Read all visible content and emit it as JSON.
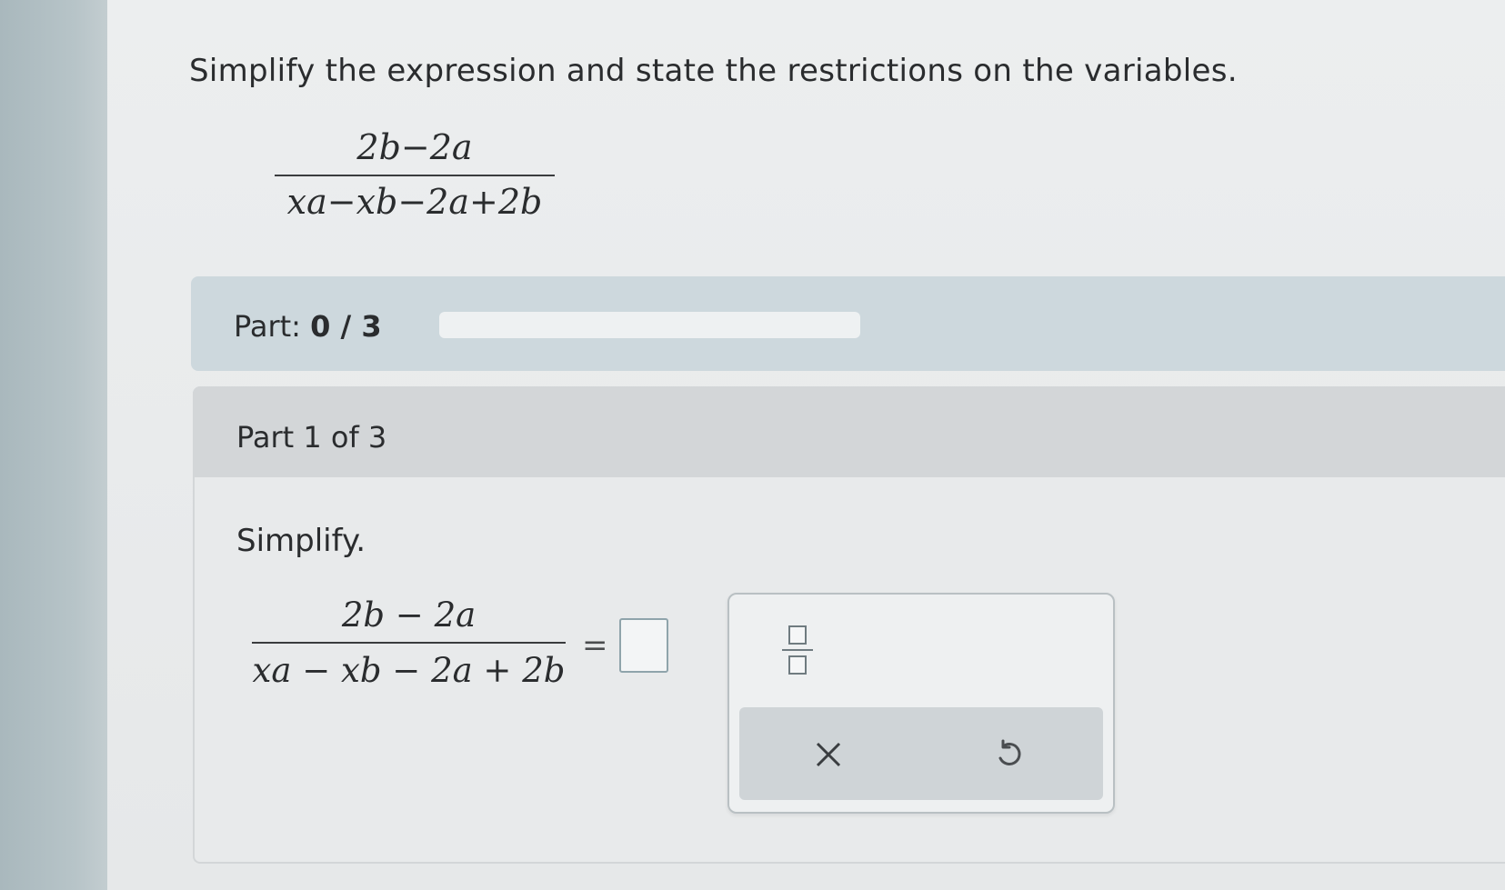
{
  "question": {
    "prompt": "Simplify the expression and state the restrictions on the variables.",
    "expression": {
      "numerator": "2b−2a",
      "denominator": "xa−xb−2a+2b"
    }
  },
  "progress": {
    "label": "Part:",
    "value": "0 / 3",
    "fraction": 0
  },
  "part": {
    "heading": "Part 1 of 3",
    "instruction": "Simplify.",
    "expression": {
      "numerator": "2b − 2a",
      "denominator": "xa − xb − 2a + 2b"
    },
    "equals": "=",
    "answer_value": ""
  },
  "palette": {
    "fraction_template_icon": "fraction-template-icon",
    "clear_icon": "close-icon",
    "clear_glyph": "✕",
    "undo_icon": "undo-icon"
  },
  "colors": {
    "part_bar": "#cdd8dd",
    "part_header": "#d3d6d8",
    "answer_box_border": "#8fa4ab"
  }
}
